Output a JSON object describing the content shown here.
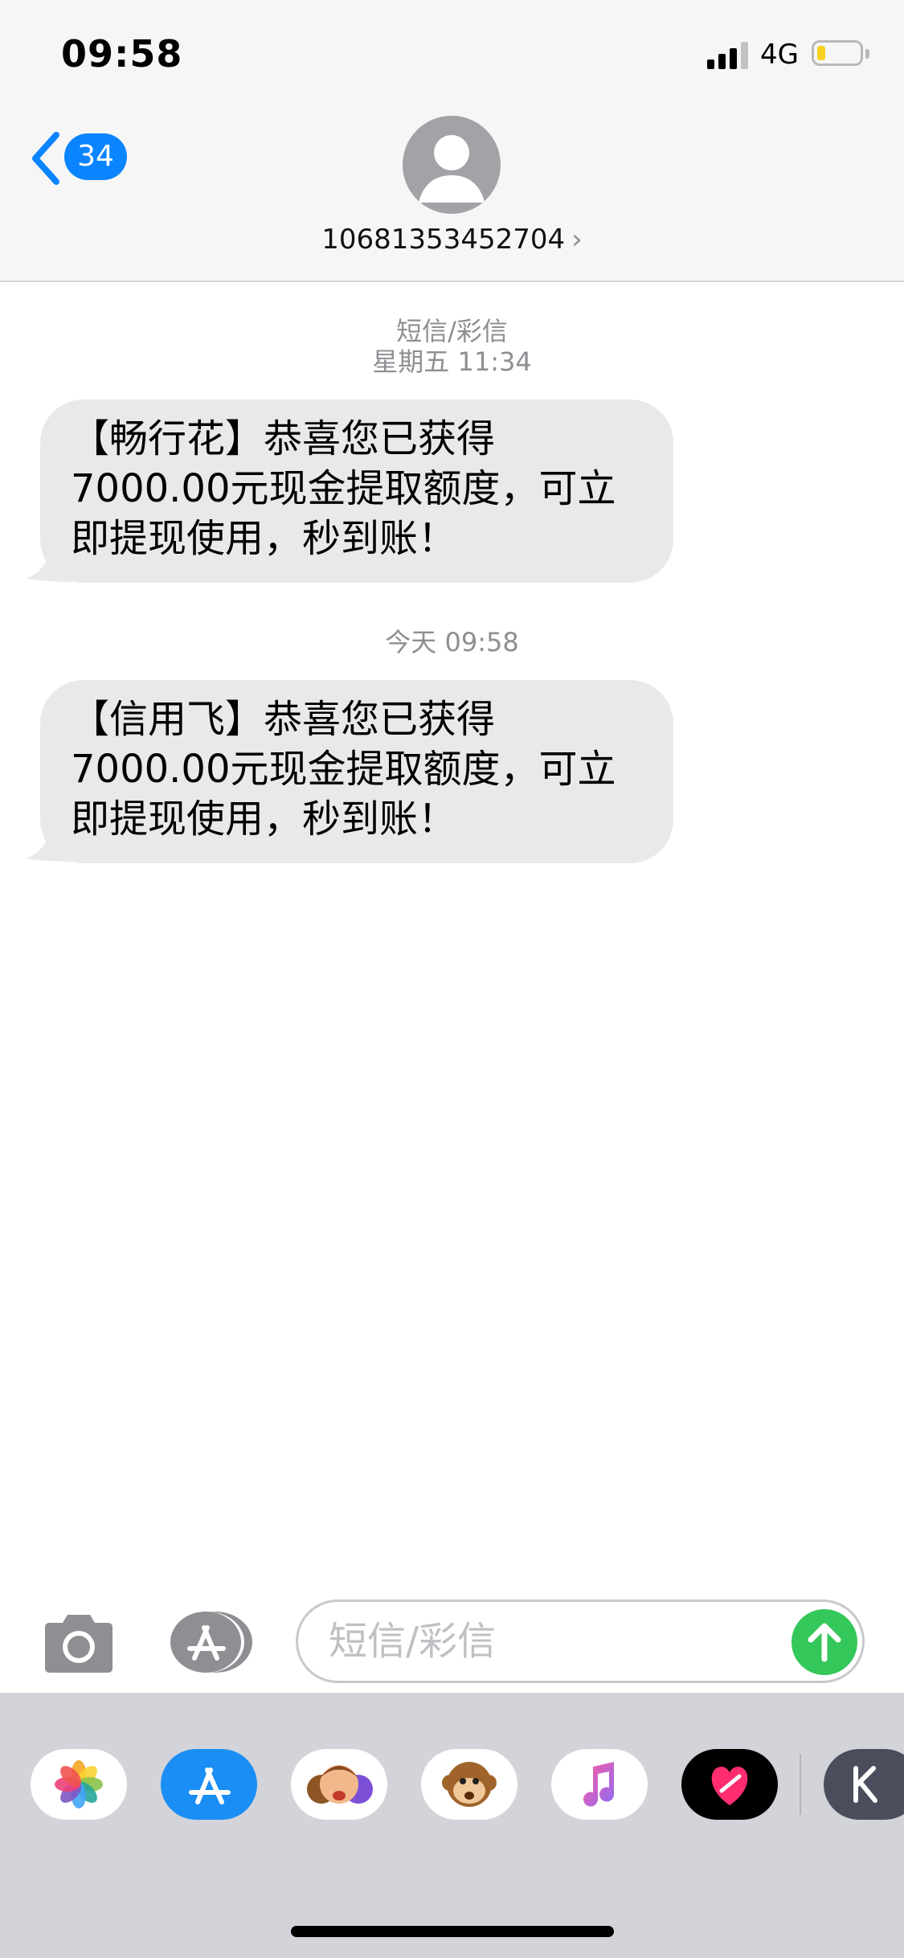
{
  "status_bar": {
    "time": "09:58",
    "network": "4G",
    "battery_color": "#f7d21f"
  },
  "nav": {
    "unread_count": "34",
    "contact_number": "10681353452704",
    "contact_chevron": "›",
    "accent_color": "#0a84ff"
  },
  "conversation": {
    "header_type": "短信/彩信",
    "timestamp_1": "星期五 11:34",
    "message_1": "【畅行花】恭喜您已获得7000.00元现金提取额度，可立即提现使用，秒到账！",
    "timestamp_2": "今天 09:58",
    "message_2": "【信用飞】恭喜您已获得7000.00元现金提取额度，可立即提现使用，秒到账！",
    "bubble_color": "#e9e9eb"
  },
  "compose": {
    "placeholder": "短信/彩信",
    "camera_icon": "camera-icon",
    "apps_icon": "app-store-icon",
    "send_icon": "send-arrow-icon",
    "send_color": "#34c759"
  },
  "app_drawer": {
    "apps": [
      "photos-app-icon",
      "app-store-app-icon",
      "memoji-app-icon",
      "animoji-app-icon",
      "music-app-icon",
      "heart-app-icon",
      "k-app-icon"
    ]
  }
}
